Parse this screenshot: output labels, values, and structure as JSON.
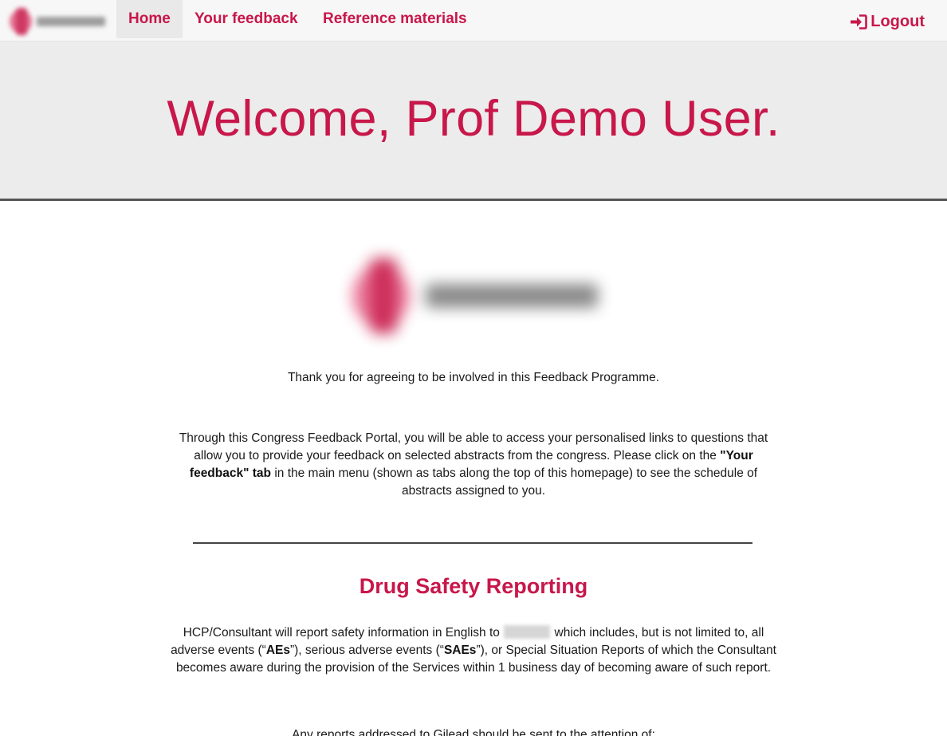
{
  "navbar": {
    "brand_icon": "company-logo",
    "tabs": [
      {
        "label": "Home",
        "active": true
      },
      {
        "label": "Your feedback",
        "active": false
      },
      {
        "label": "Reference materials",
        "active": false
      }
    ],
    "logout": {
      "label": "Logout",
      "icon": "sign-in-arrow-icon"
    }
  },
  "hero": {
    "title": "Welcome, Prof Demo User."
  },
  "content": {
    "thanks": "Thank you for agreeing to be involved in this Feedback Programme.",
    "portal": {
      "intro": "Through this Congress Feedback Portal, you will be able to access your personalised links to questions that allow you to provide your feedback on selected abstracts from the congress. Please click on the ",
      "bold": "\"Your feedback\" tab",
      "outro": " in the main menu (shown as tabs along the top of this homepage) to see the schedule of abstracts assigned to you."
    },
    "safety_title": "Drug Safety Reporting",
    "safety": {
      "part1": "HCP/Consultant will report safety information in English to",
      "part2": "which includes, but is not limited to, all adverse events (“",
      "aes": "AEs",
      "part3": "”), serious adverse events (“",
      "saes": "SAEs",
      "part4": "”), or Special Situation Reports of which the Consultant becomes aware during the provision of the Services within 1 business day of becoming aware of such report."
    },
    "gilead_line": "Any reports addressed to Gilead should be sent to the attention of:"
  },
  "colors": {
    "accent": "#c8174a",
    "navbar_bg": "#f7f7f7",
    "hero_bg": "#ececec",
    "hero_border": "#555555"
  }
}
